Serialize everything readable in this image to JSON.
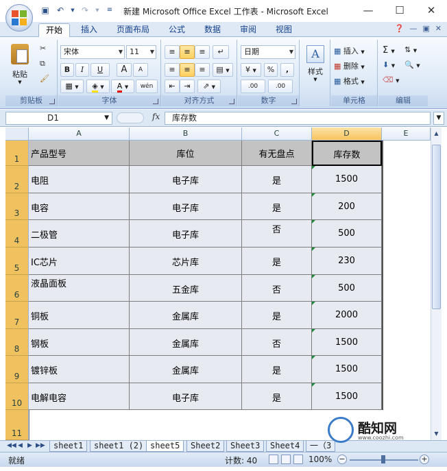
{
  "window": {
    "title": "新建 Microsoft Office Excel 工作表 - Microsoft Excel"
  },
  "tabs": [
    "开始",
    "插入",
    "页面布局",
    "公式",
    "数据",
    "审阅",
    "视图"
  ],
  "ribbon": {
    "clipboard": {
      "label": "剪贴板",
      "paste": "粘贴"
    },
    "font": {
      "label": "字体",
      "font_name": "宋体",
      "font_size": "11",
      "bold": "B",
      "italic": "I",
      "underline": "U",
      "grow": "A",
      "shrink": "A",
      "wen": "wén"
    },
    "alignment": {
      "label": "对齐方式"
    },
    "number": {
      "label": "数字",
      "format": "日期",
      "percent": "%",
      "comma": ",",
      "inc_dec": ".00",
      "dec_dec": ".00"
    },
    "styles": {
      "label": "样式"
    },
    "cells": {
      "label": "单元格",
      "insert": "插入",
      "delete": "删除",
      "format": "格式"
    },
    "editing": {
      "label": "编辑",
      "sum": "Σ"
    }
  },
  "formula_bar": {
    "name_box": "D1",
    "fx": "fx",
    "content": "库存数"
  },
  "columns": [
    "A",
    "B",
    "C",
    "D",
    "E"
  ],
  "rows": [
    "1",
    "2",
    "3",
    "4",
    "5",
    "6",
    "7",
    "8",
    "9",
    "10",
    "11"
  ],
  "table": {
    "headers": [
      "产品型号",
      "库位",
      "有无盘点",
      "库存数"
    ],
    "data": [
      [
        "电阻",
        "电子库",
        "是",
        "1500"
      ],
      [
        "电容",
        "电子库",
        "是",
        "200"
      ],
      [
        "二极管",
        "电子库",
        "否",
        "500"
      ],
      [
        "IC芯片",
        "芯片库",
        "是",
        "230"
      ],
      [
        "液晶面板",
        "五金库",
        "否",
        "500"
      ],
      [
        "铜板",
        "金属库",
        "是",
        "2000"
      ],
      [
        "钢板",
        "金属库",
        "否",
        "1500"
      ],
      [
        "镀锌板",
        "金属库",
        "是",
        "1500"
      ],
      [
        "电解电容",
        "电子库",
        "是",
        "1500"
      ]
    ]
  },
  "sheets": [
    "sheet1",
    "sheet1 (2)",
    "sheet5",
    "Sheet2",
    "Sheet3",
    "Sheet4",
    "一（3"
  ],
  "active_sheet": "sheet5",
  "status": {
    "ready": "就绪",
    "count": "计数: 40",
    "zoom": "100%"
  },
  "watermark": {
    "brand": "酷知网",
    "url": "www.coozhi.com"
  }
}
